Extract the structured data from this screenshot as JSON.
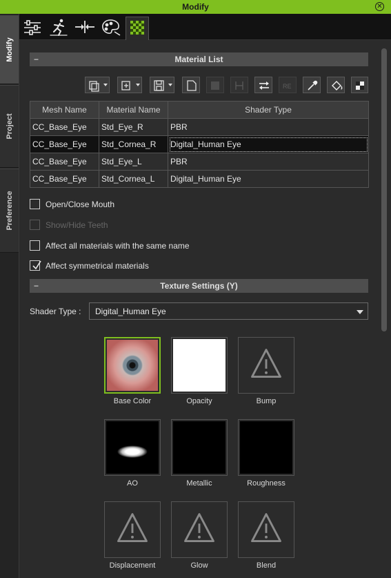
{
  "window": {
    "title": "Modify"
  },
  "side_tabs": [
    {
      "label": "Modify",
      "active": true
    },
    {
      "label": "Project",
      "active": false
    },
    {
      "label": "Preference",
      "active": false
    }
  ],
  "toolbar_icons": [
    "sliders-icon",
    "pose-figure-icon",
    "morph-arrows-icon",
    "palette-icon",
    "checker-texture-icon"
  ],
  "material_list": {
    "header": "Material List",
    "columns": [
      "Mesh Name",
      "Material Name",
      "Shader Type"
    ],
    "rows": [
      [
        "CC_Base_Eye",
        "Std_Eye_R",
        "PBR"
      ],
      [
        "CC_Base_Eye",
        "Std_Cornea_R",
        "Digital_Human Eye"
      ],
      [
        "CC_Base_Eye",
        "Std_Eye_L",
        "PBR"
      ],
      [
        "CC_Base_Eye",
        "Std_Cornea_L",
        "Digital_Human Eye"
      ]
    ],
    "selected_row": 1
  },
  "options": [
    {
      "label": "Open/Close Mouth",
      "checked": false,
      "disabled": false
    },
    {
      "label": "Show/Hide Teeth",
      "checked": false,
      "disabled": true
    },
    {
      "label": "Affect all materials with the same name",
      "checked": false,
      "disabled": false
    },
    {
      "label": "Affect symmetrical materials",
      "checked": true,
      "disabled": false
    }
  ],
  "texture_settings": {
    "header": "Texture Settings  (Y)",
    "shader_label": "Shader Type :",
    "shader_value": "Digital_Human Eye",
    "channels": [
      "Base Color",
      "Opacity",
      "Bump",
      "AO",
      "Metallic",
      "Roughness",
      "Displacement",
      "Glow",
      "Blend"
    ]
  },
  "colors": {
    "accent": "#7fbf1f",
    "panel": "#2b2b2b",
    "header": "#4e4e4e"
  }
}
